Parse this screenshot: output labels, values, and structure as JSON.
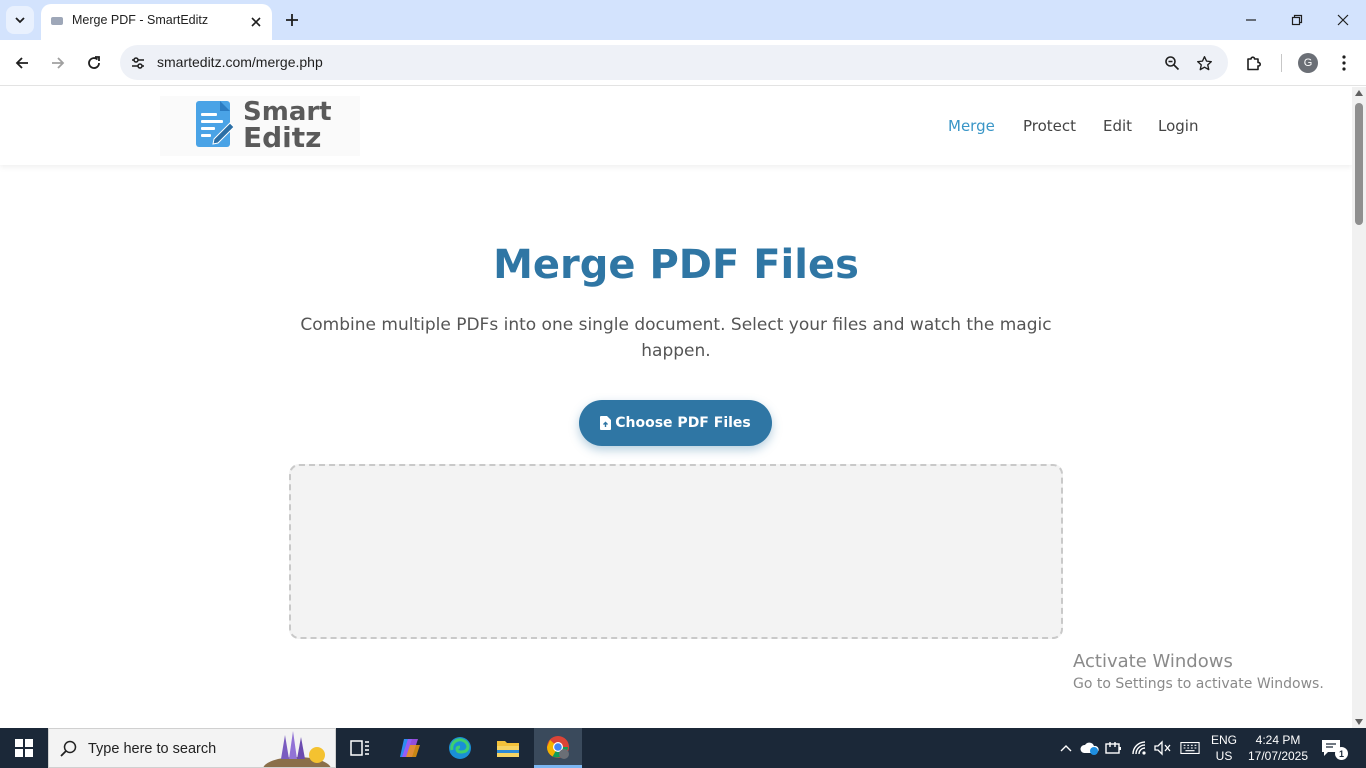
{
  "browser": {
    "tab_title": "Merge PDF - SmartEditz",
    "url": "smarteditz.com/merge.php",
    "profile_initial": "G"
  },
  "site": {
    "logo_line1": "Smart",
    "logo_line2": "Editz",
    "nav": [
      {
        "label": "Merge",
        "active": true
      },
      {
        "label": "Protect",
        "active": false
      },
      {
        "label": "Edit",
        "active": false
      },
      {
        "label": "Login",
        "active": false
      }
    ],
    "hero_title": "Merge PDF Files",
    "hero_subtitle": "Combine multiple PDFs into one single document. Select your files and watch the magic happen.",
    "choose_button": "Choose PDF Files",
    "colors": {
      "accent": "#2f76a4",
      "nav_active": "#3a96c7",
      "dropzone": "#f3f3f3"
    }
  },
  "watermark": {
    "title": "Activate Windows",
    "subtitle": "Go to Settings to activate Windows."
  },
  "taskbar": {
    "search_placeholder": "Type here to search",
    "lang_line1": "ENG",
    "lang_line2": "US",
    "time": "4:24 PM",
    "date": "17/07/2025",
    "notification_count": "1",
    "apps": [
      "task-view",
      "copilot",
      "edge",
      "file-explorer",
      "chrome"
    ]
  }
}
